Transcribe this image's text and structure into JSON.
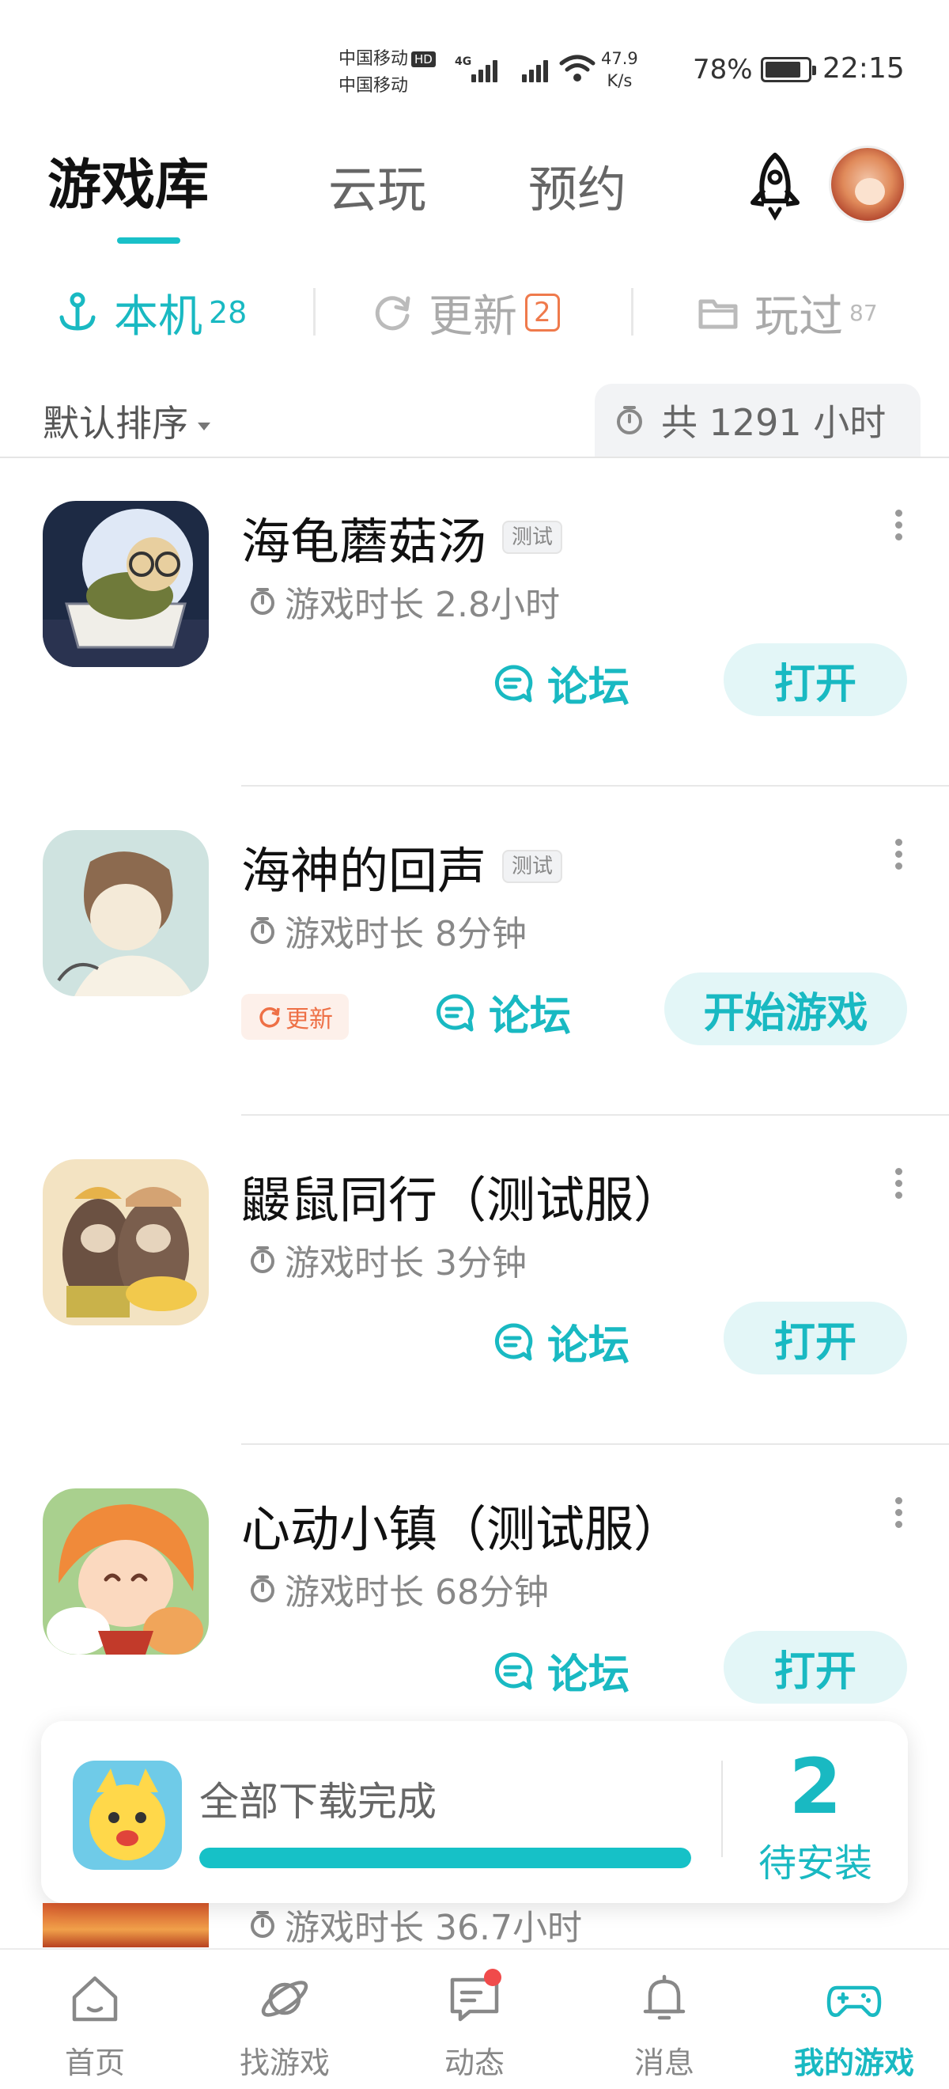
{
  "status_bar": {
    "carrier1": "中国移动",
    "carrier2": "中国移动",
    "hd": "HD",
    "network": "4G",
    "speed_value": "47.9",
    "speed_unit": "K/s",
    "battery_percent": "78%",
    "time": "22:15"
  },
  "header": {
    "tabs": [
      {
        "label": "游戏库",
        "active": true
      },
      {
        "label": "云玩",
        "active": false
      },
      {
        "label": "预约",
        "active": false
      }
    ]
  },
  "subtabs": {
    "local": {
      "label": "本机",
      "count": "28"
    },
    "update": {
      "label": "更新",
      "count": "2"
    },
    "played": {
      "label": "玩过",
      "count": "87"
    }
  },
  "sort": {
    "label": "默认排序",
    "total": "共 1291 小时"
  },
  "games": [
    {
      "title": "海龟蘑菇汤",
      "tag": "测试",
      "time": "游戏时长 2.8小时",
      "forum": "论坛",
      "action": "打开",
      "update": ""
    },
    {
      "title": "海神的回声",
      "tag": "测试",
      "time": "游戏时长 8分钟",
      "forum": "论坛",
      "action": "开始游戏",
      "update": "更新"
    },
    {
      "title": "鼹鼠同行（测试服）",
      "tag": "",
      "time": "游戏时长 3分钟",
      "forum": "论坛",
      "action": "打开",
      "update": ""
    },
    {
      "title": "心动小镇（测试服）",
      "tag": "",
      "time": "游戏时长 68分钟",
      "forum": "论坛",
      "action": "打开",
      "update": ""
    },
    {
      "title": "",
      "tag": "",
      "time": "游戏时长 36.7小时",
      "forum": "",
      "action": "",
      "update": ""
    }
  ],
  "download_banner": {
    "text": "全部下载完成",
    "progress": 1.0,
    "count": "2",
    "pending_label": "待安装"
  },
  "bottom_nav": [
    {
      "label": "首页",
      "icon": "home-icon",
      "active": false
    },
    {
      "label": "找游戏",
      "icon": "planet-icon",
      "active": false
    },
    {
      "label": "动态",
      "icon": "chat-icon",
      "active": false,
      "dot": true
    },
    {
      "label": "消息",
      "icon": "bell-icon",
      "active": false
    },
    {
      "label": "我的游戏",
      "icon": "gamepad-icon",
      "active": true
    }
  ],
  "colors": {
    "accent": "#19b9c2",
    "update": "#ee7046",
    "notification_dot": "#f04b4b"
  }
}
